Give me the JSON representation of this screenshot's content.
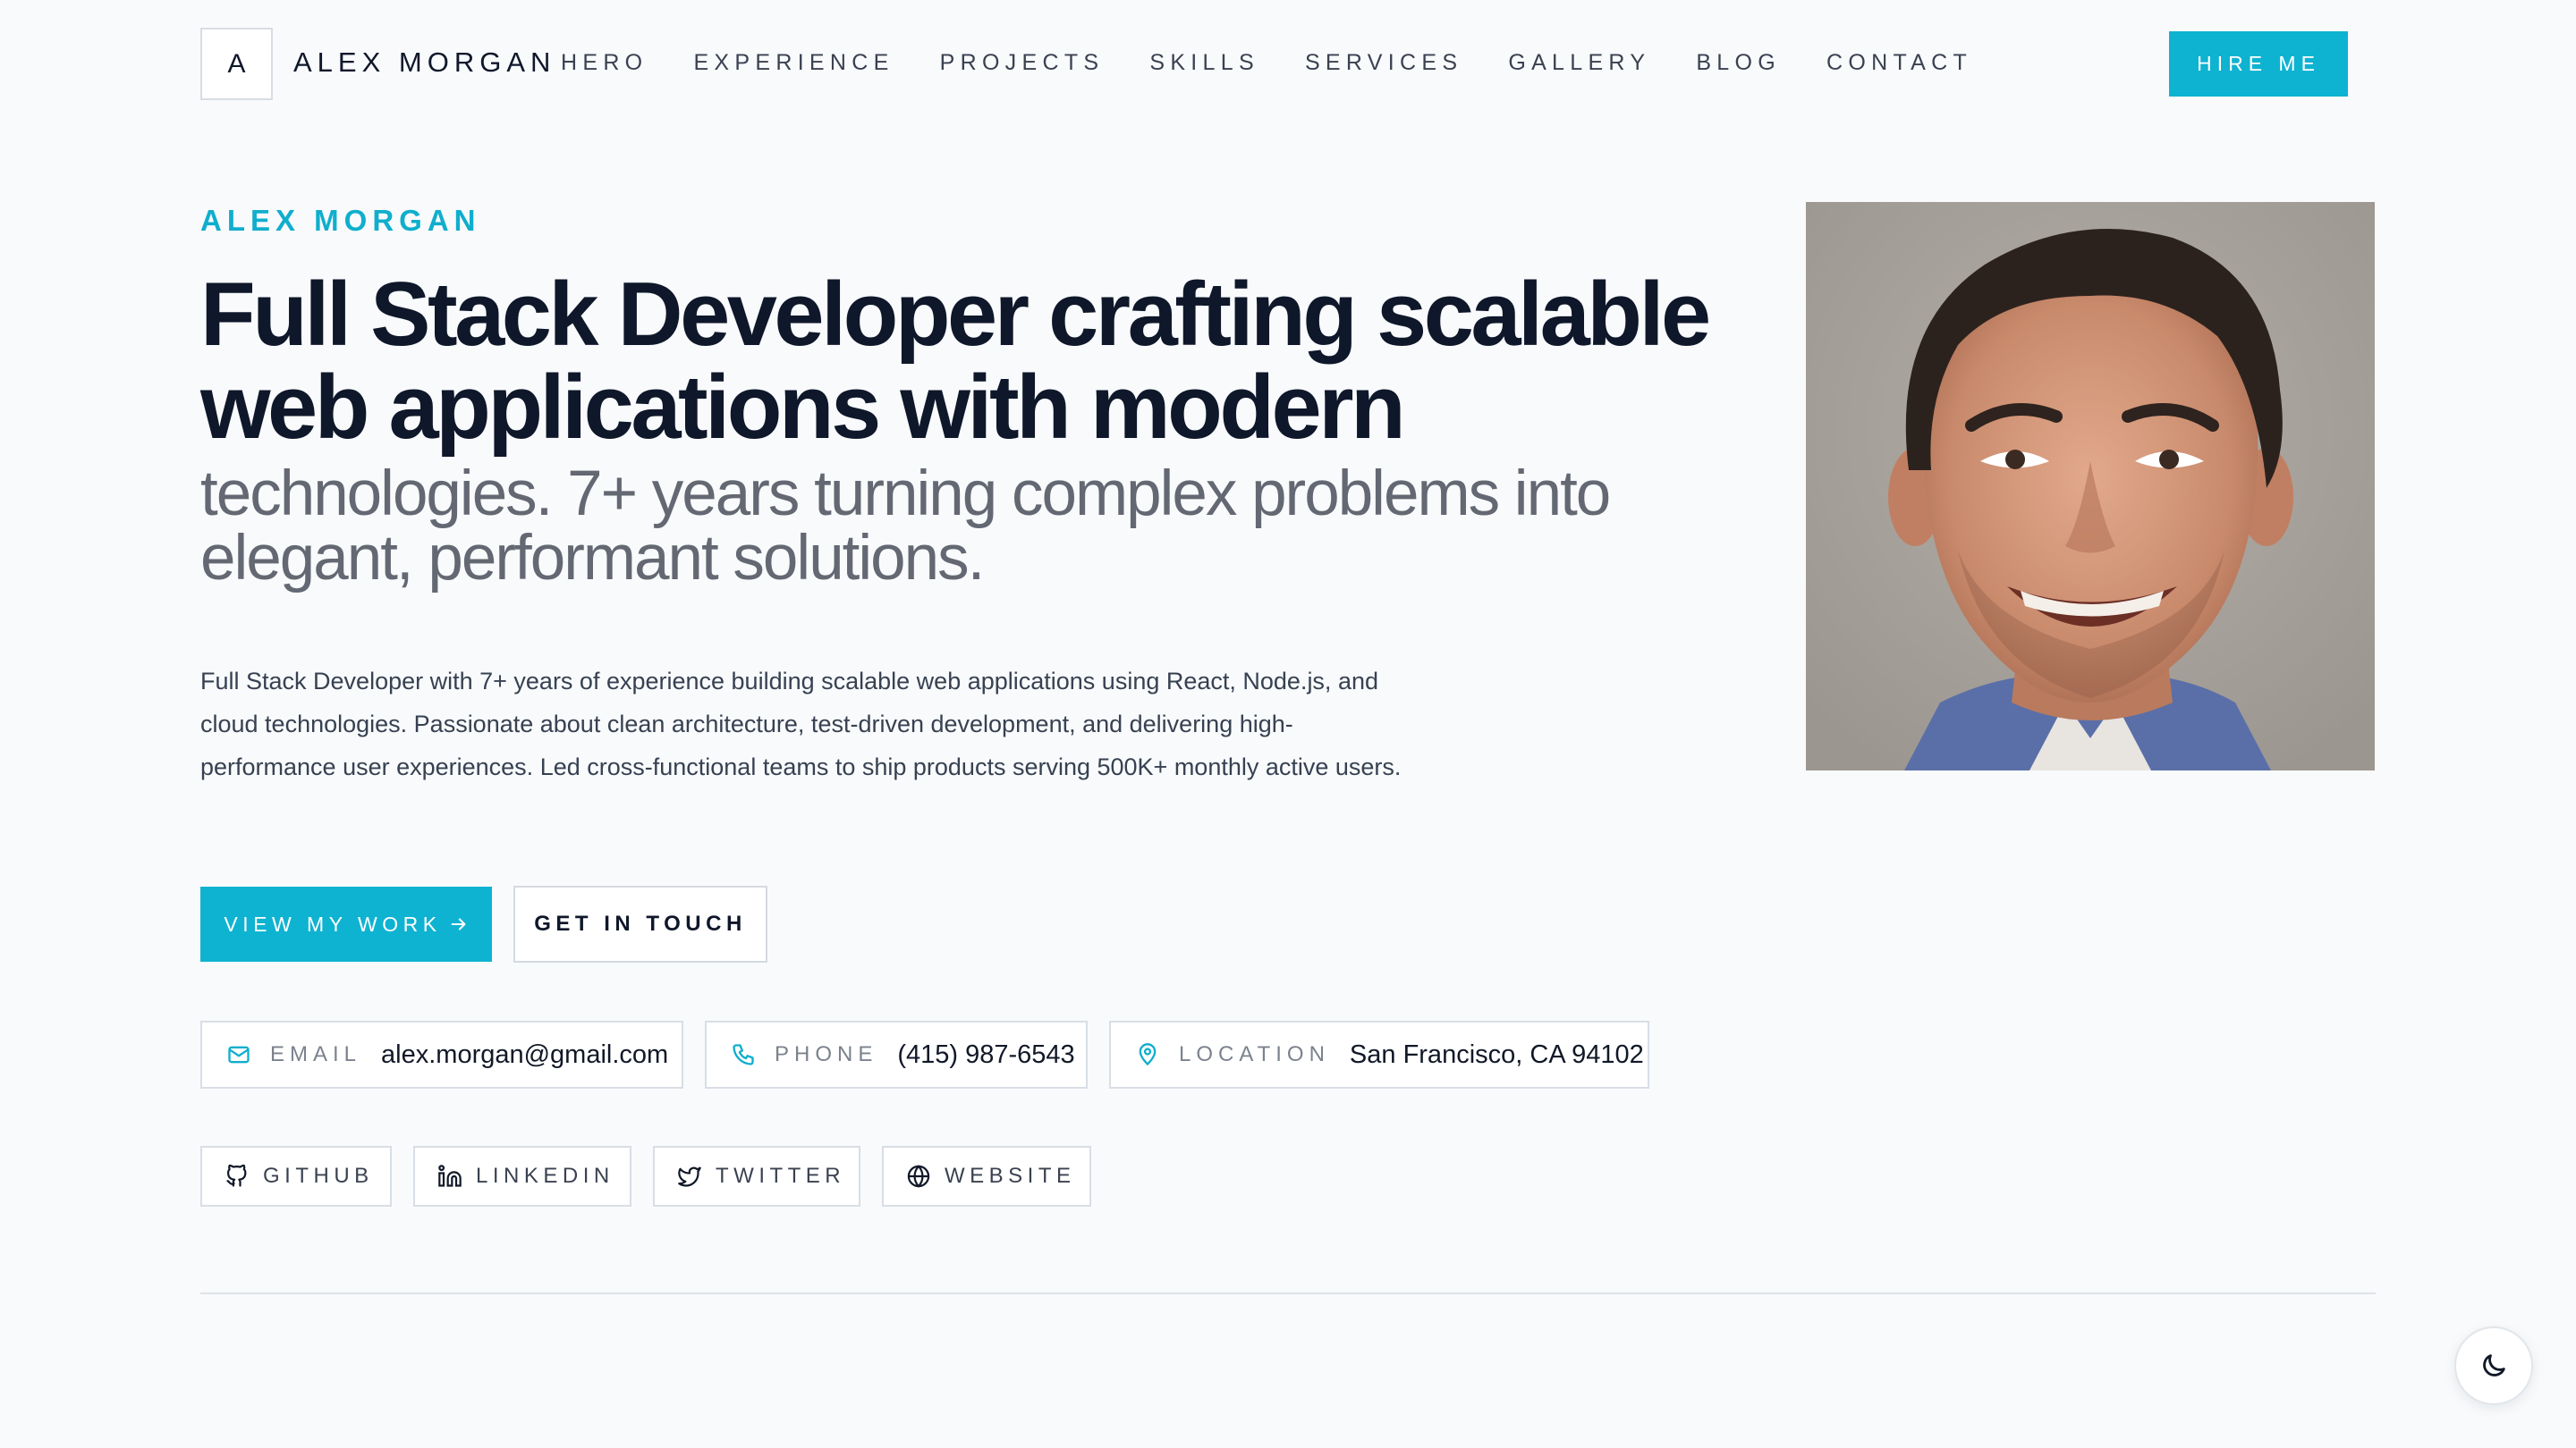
{
  "nav": {
    "logo_letter": "A",
    "brand": "ALEX MORGAN",
    "links": [
      "HERO",
      "EXPERIENCE",
      "PROJECTS",
      "SKILLS",
      "SERVICES",
      "GALLERY",
      "BLOG",
      "CONTACT"
    ],
    "cta": "HIRE ME"
  },
  "hero": {
    "eyebrow": "ALEX MORGAN",
    "headline": "Full Stack Developer crafting scalable web applications with modern",
    "subheadline": "technologies. 7+ years turning complex problems into elegant, performant solutions.",
    "bio": "Full Stack Developer with 7+ years of experience building scalable web applications using React, Node.js, and cloud technologies. Passionate about clean architecture, test-driven development, and delivering high-performance user experiences. Led cross-functional teams to ship products serving 500K+ monthly active users.",
    "primary_cta": "VIEW MY WORK",
    "secondary_cta": "GET IN TOUCH"
  },
  "contact": {
    "email_label": "EMAIL",
    "email": "alex.morgan@gmail.com",
    "phone_label": "PHONE",
    "phone": "(415) 987-6543",
    "location_label": "LOCATION",
    "location": "San Francisco, CA 94102"
  },
  "social": {
    "github": "GITHUB",
    "linkedin": "LINKEDIN",
    "twitter": "TWITTER",
    "website": "WEBSITE"
  },
  "colors": {
    "accent": "#0eb3d1",
    "background": "#f8fafc",
    "text": "#0f172a"
  }
}
